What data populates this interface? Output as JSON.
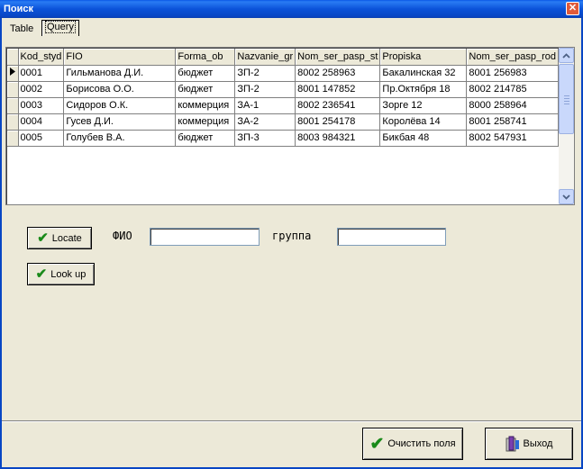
{
  "window": {
    "title": "Поиск",
    "close_glyph": "✕"
  },
  "tabs": [
    {
      "label": "Table"
    },
    {
      "label": "Query"
    }
  ],
  "grid": {
    "columns": [
      "Kod_styd",
      "FIO",
      "Forma_ob",
      "Nazvanie_gr",
      "Nom_ser_pasp_st",
      "Propiska",
      "Nom_ser_pasp_rod"
    ],
    "rows": [
      [
        "0001",
        "Гильманова Д.И.",
        "бюджет",
        "ЗП-2",
        "8002 258963",
        "Бакалинская 32",
        "8001 256983"
      ],
      [
        "0002",
        "Борисова О.О.",
        "бюджет",
        "ЗП-2",
        "8001 147852",
        "Пр.Октября 18",
        "8002 214785"
      ],
      [
        "0003",
        "Сидоров О.К.",
        "коммерция",
        "ЗА-1",
        "8002 236541",
        "Зорге 12",
        "8000 258964"
      ],
      [
        "0004",
        "Гусев Д.И.",
        "коммерция",
        "ЗА-2",
        "8001 254178",
        "Королёва 14",
        "8001 258741"
      ],
      [
        "0005",
        "Голубев В.А.",
        "бюджет",
        "ЗП-3",
        "8003 984321",
        "Бикбая 48",
        "8002 547931"
      ]
    ]
  },
  "search": {
    "locate_label": "Locate",
    "lookup_label": "Look up",
    "fio_label": "ФИО",
    "fio_value": "",
    "group_label": "группа",
    "group_value": ""
  },
  "footer": {
    "clear_label": "Очистить поля",
    "exit_label": "Выход"
  }
}
